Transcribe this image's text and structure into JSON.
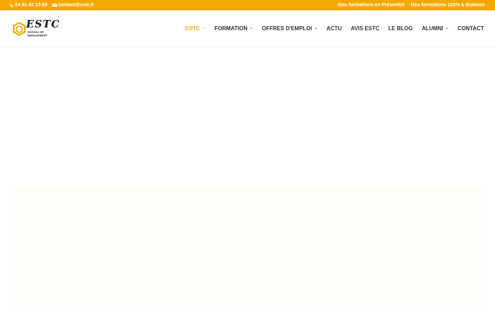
{
  "topbar": {
    "phone_icon": "phone-icon",
    "phone": "04 91 62 15 84",
    "email_icon": "envelope-icon",
    "email": "contact@estc.fr",
    "link_presentiel": "Nos formations en Présentiel",
    "link_distance": "Nos formations 100% à distance",
    "background": "#f5a800"
  },
  "header": {
    "logo": {
      "text": "ESTC",
      "subtitle": "SCHOOL OF MANAGEMENT"
    },
    "nav": [
      {
        "label": "ESTC",
        "has_dropdown": true,
        "active": true
      },
      {
        "label": "FORMATION",
        "has_dropdown": true
      },
      {
        "label": "OFFRES D'EMPLOI",
        "has_dropdown": true
      },
      {
        "label": "ACTU"
      },
      {
        "label": "AVIS ESTC"
      },
      {
        "label": "LE BLOG"
      },
      {
        "label": "ALUMNI",
        "has_dropdown": true
      },
      {
        "label": "CONTACT"
      }
    ],
    "chevron": "⌄",
    "accent": "#f5a800"
  }
}
